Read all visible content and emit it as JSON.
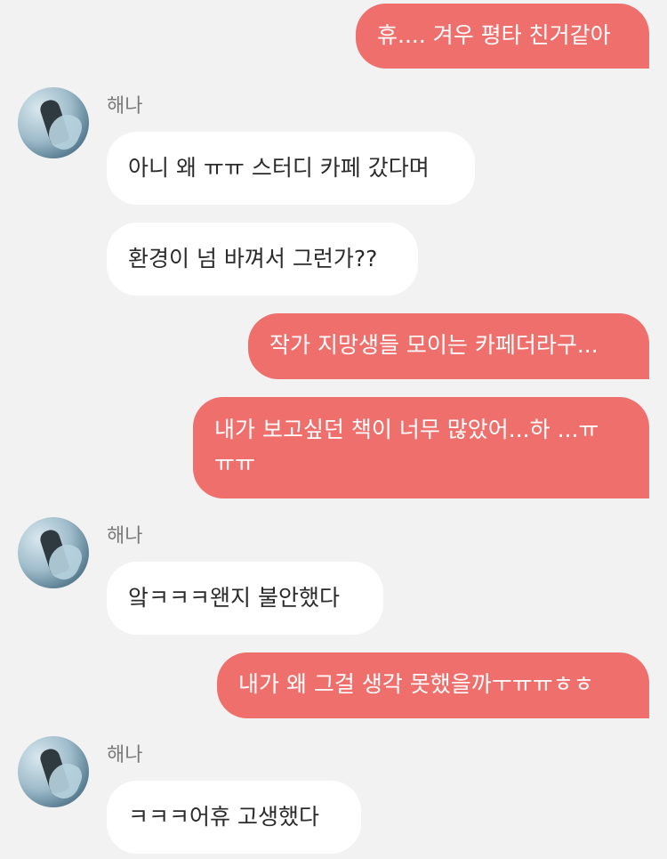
{
  "contact_name": "해나",
  "messages": [
    {
      "text": "휴.... 겨우 평타 친거같아"
    },
    {
      "text": "아니 왜 ㅠㅠ 스터디 카페 갔다며"
    },
    {
      "text": "환경이 넘 바껴서 그런가??"
    },
    {
      "text": "작가 지망생들 모이는 카페더라구..."
    },
    {
      "line1": "내가 보고싶던 책이 너무 많았어...하 ...ㅠ",
      "line2": "ㅠㅠ"
    },
    {
      "text": "앜ㅋㅋㅋ왠지 불안했다"
    },
    {
      "text": "내가 왜 그걸 생각 못했을까ㅜㅠㅠㅎㅎ"
    },
    {
      "text": "ㅋㅋㅋ어휴 고생했다"
    }
  ],
  "colors": {
    "background": "#f2f2f2",
    "sent_bubble": "#ee6f6b",
    "received_bubble": "#ffffff"
  }
}
